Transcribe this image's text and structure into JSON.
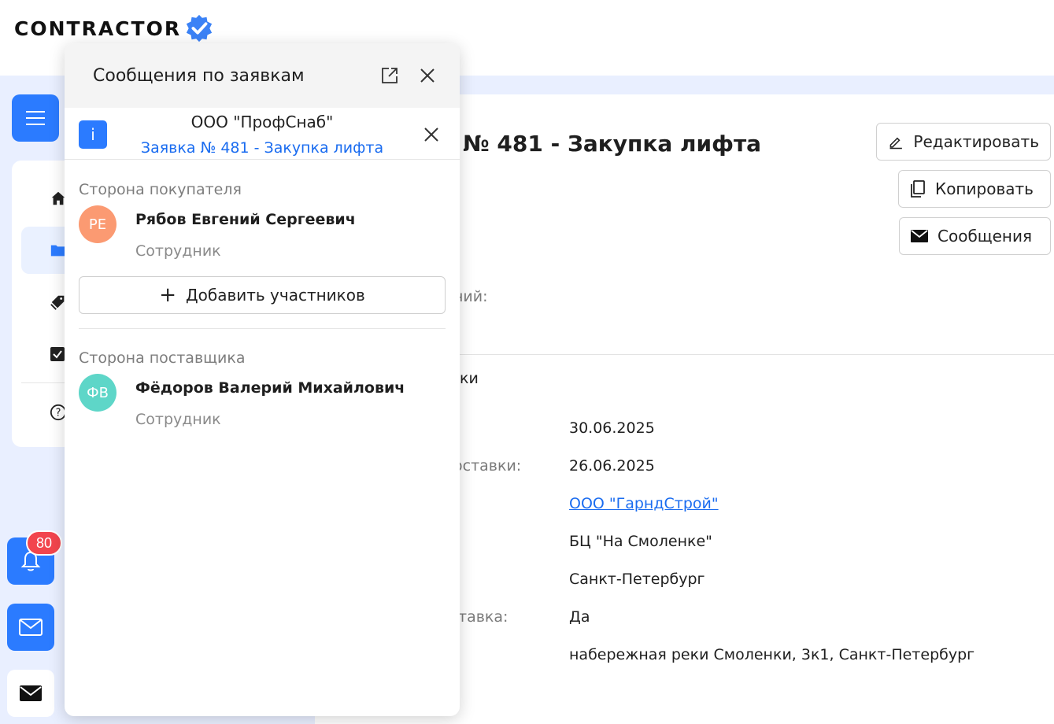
{
  "header": {
    "logo_text": "CONTRACTOR",
    "logo_badge_icon": "verified-check-icon"
  },
  "colors": {
    "accent": "#2b7bff",
    "link": "#1a6cf0",
    "badge": "#f2454d",
    "avatar_buyer": "#fb9a72",
    "avatar_supplier": "#5ed6c8",
    "page_bg": "#e9efff"
  },
  "sidebar": {
    "menu_icon": "hamburger-icon",
    "items": [
      {
        "icon": "home-icon"
      },
      {
        "icon": "folder-icon",
        "active": true
      },
      {
        "icon": "tags-icon"
      },
      {
        "icon": "checkbox-icon"
      },
      {
        "icon": "help-icon"
      }
    ],
    "notifications_count": "80"
  },
  "main": {
    "title": "№ 481 - Закупка лифта",
    "buttons": {
      "edit": "Редактировать",
      "copy": "Копировать",
      "messages": "Сообщения"
    },
    "fragments": {
      "f1": "ний:",
      "f2": "ки",
      "f3": "оставки:",
      "f4": "тавка:"
    },
    "values": {
      "date1": "30.06.2025",
      "date2": "26.06.2025",
      "supplier": "ООО \"ГарндСтрой\"",
      "location": "БЦ \"На Смоленке\"",
      "city": "Санкт-Петербург",
      "delivery": "Да",
      "address": "набережная реки Смоленки, 3к1, Санкт-Петербург"
    }
  },
  "panel": {
    "title": "Сообщения по заявкам",
    "chat": {
      "info_letter": "i",
      "company": "ООО \"ПрофСнаб\"",
      "request": "Заявка № 481 - Закупка лифта"
    },
    "buyer": {
      "label": "Сторона покупателя",
      "initials": "РЕ",
      "name": "Рябов Евгений Сергеевич",
      "role": "Сотрудник"
    },
    "add_label": "Добавить участников",
    "supplier": {
      "label": "Сторона поставщика",
      "initials": "ФВ",
      "name": "Фёдоров Валерий Михайлович",
      "role": "Сотрудник"
    }
  }
}
